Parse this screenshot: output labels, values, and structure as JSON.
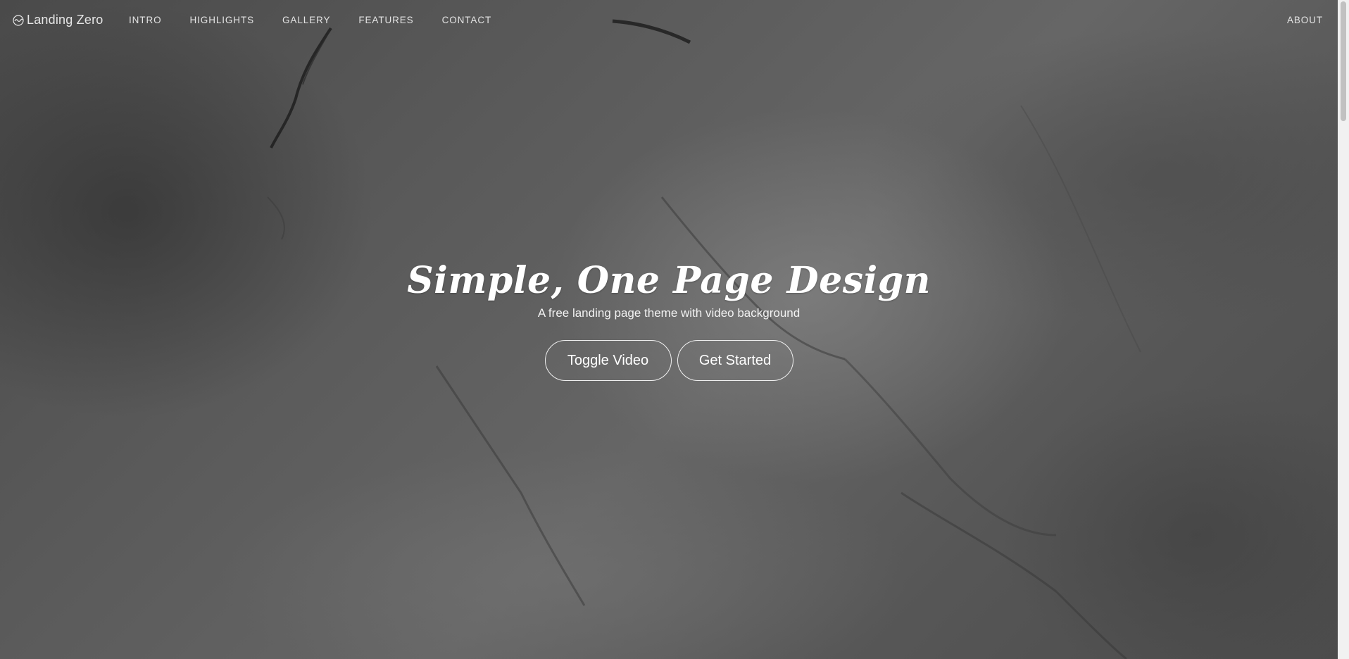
{
  "brand": {
    "name": "Landing Zero",
    "icon": "wave-circle-icon"
  },
  "nav": {
    "links": [
      {
        "label": "INTRO"
      },
      {
        "label": "HIGHLIGHTS"
      },
      {
        "label": "GALLERY"
      },
      {
        "label": "FEATURES"
      },
      {
        "label": "CONTACT"
      }
    ],
    "about": "ABOUT"
  },
  "hero": {
    "title": "Simple, One Page Design",
    "subtitle": "A free landing page theme with video background",
    "buttons": {
      "toggle_video": "Toggle Video",
      "get_started": "Get Started"
    }
  },
  "colors": {
    "text": "#ffffff",
    "nav_text": "#e4e4e4",
    "background": "#5a5a5a"
  }
}
